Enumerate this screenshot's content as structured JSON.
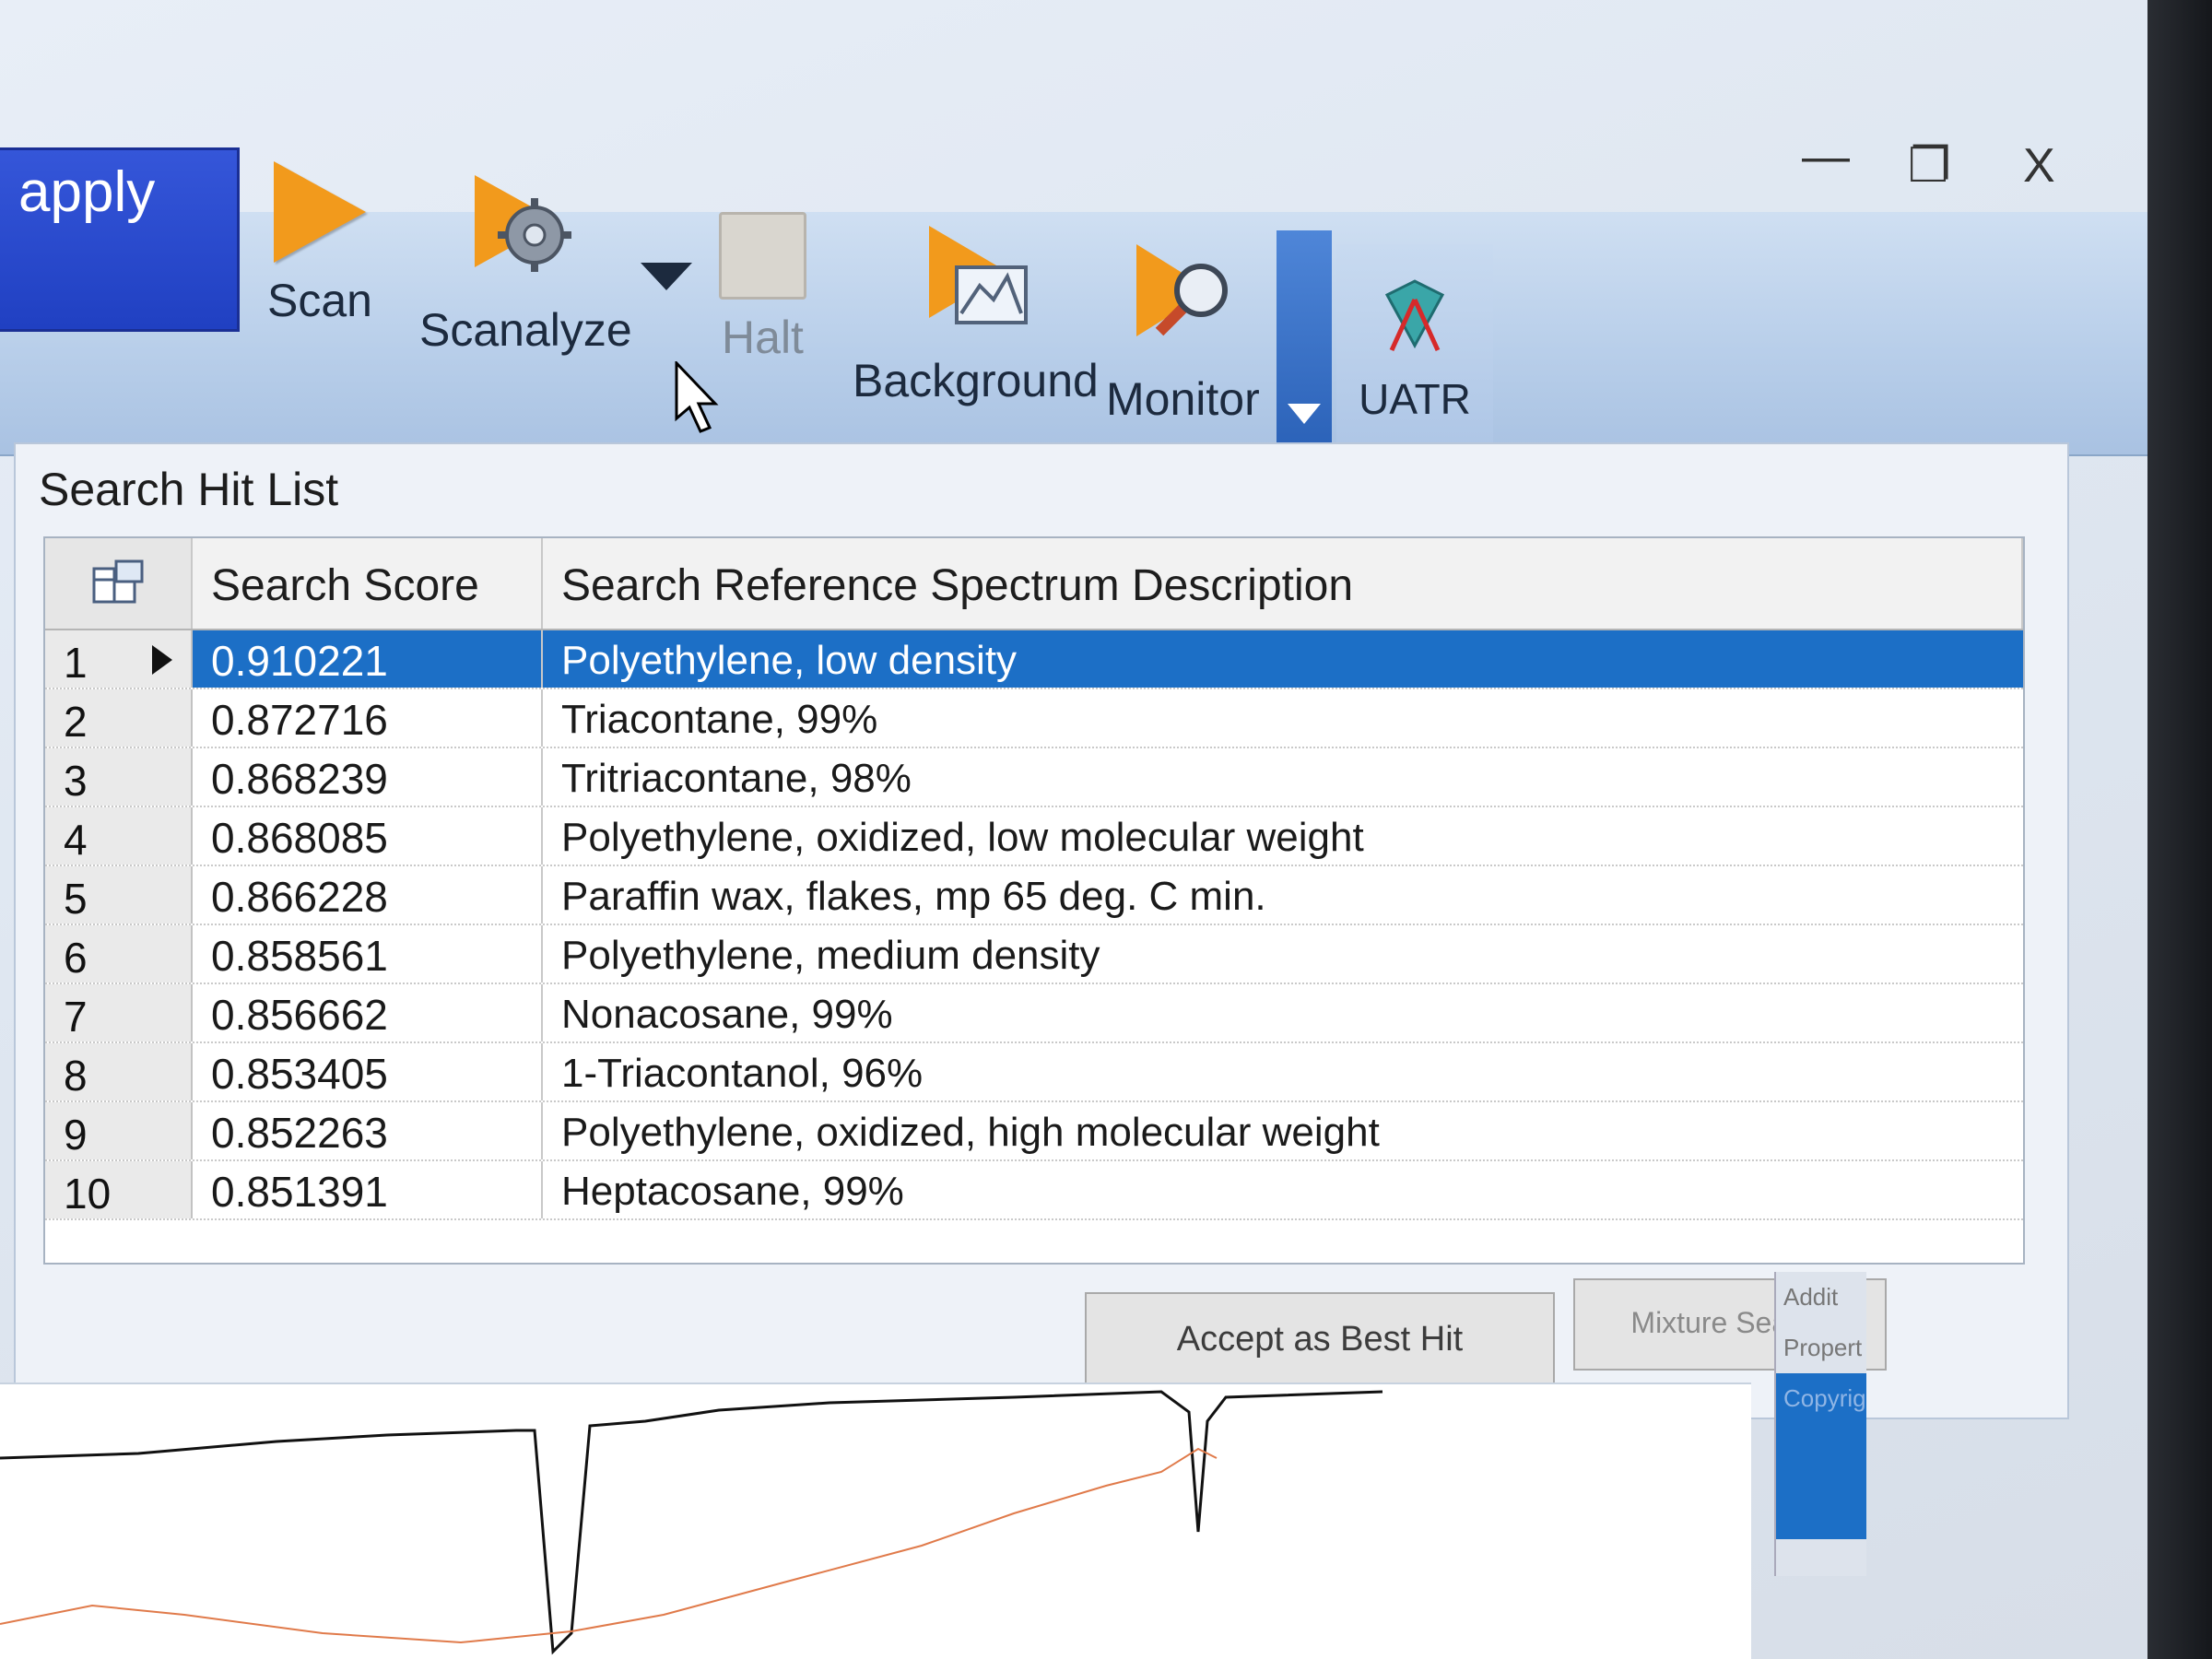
{
  "window": {
    "controls": {
      "minimize": "—",
      "restore": "❐",
      "close": "X"
    }
  },
  "ribbon": {
    "apply_label": "apply",
    "tools": {
      "scan": "Scan",
      "scanalyze": "Scanalyze",
      "halt": "Halt",
      "background": "Background",
      "monitor": "Monitor",
      "uatr": "UATR"
    }
  },
  "hit_list": {
    "title": "Search Hit List",
    "columns": {
      "score": "Search Score",
      "description": "Search Reference Spectrum Description"
    },
    "selected_row": 1,
    "rows": [
      {
        "num": "1",
        "score": "0.910221",
        "description": "Polyethylene, low density"
      },
      {
        "num": "2",
        "score": "0.872716",
        "description": "Triacontane, 99%"
      },
      {
        "num": "3",
        "score": "0.868239",
        "description": "Tritriacontane, 98%"
      },
      {
        "num": "4",
        "score": "0.868085",
        "description": "Polyethylene, oxidized, low molecular weight"
      },
      {
        "num": "5",
        "score": "0.866228",
        "description": "Paraffin wax, flakes, mp 65 deg. C min."
      },
      {
        "num": "6",
        "score": "0.858561",
        "description": "Polyethylene, medium density"
      },
      {
        "num": "7",
        "score": "0.856662",
        "description": "Nonacosane, 99%"
      },
      {
        "num": "8",
        "score": "0.853405",
        "description": "1-Triacontanol, 96%"
      },
      {
        "num": "9",
        "score": "0.852263",
        "description": "Polyethylene, oxidized, high molecular weight"
      },
      {
        "num": "10",
        "score": "0.851391",
        "description": "Heptacosane, 99%"
      }
    ],
    "buttons": {
      "accept": "Accept as Best Hit",
      "mixture": "Mixture Search"
    }
  },
  "side_panel": {
    "items": [
      "Addit",
      "Propert",
      "Copyrig"
    ]
  },
  "colors": {
    "selection": "#1c6fc6",
    "reference_trace": "#111111",
    "sample_trace": "#e07a4a",
    "accent_icon": "#f29a1c"
  }
}
